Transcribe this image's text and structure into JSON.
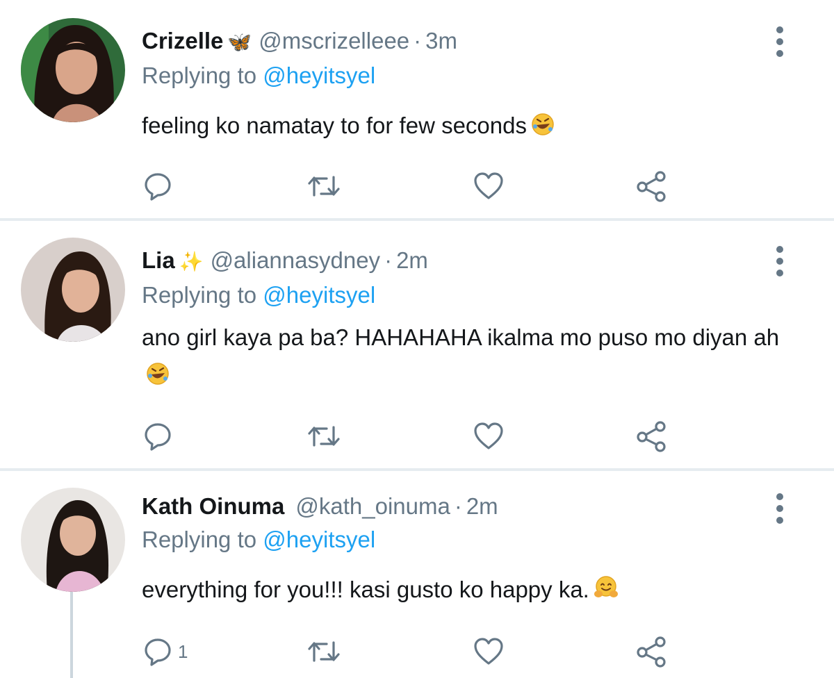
{
  "colors": {
    "accent": "#1da1f2",
    "secondary_text": "#657786",
    "divider": "#e6ecf0"
  },
  "replies": [
    {
      "name": "Crizelle",
      "badge": "🦋",
      "handle": "@mscrizelleee",
      "separator": "·",
      "time": "3m",
      "replying_label": "Replying to",
      "replying_to": "@heyitsyel",
      "text": "feeling ko namatay to for few seconds",
      "emoji": "rolling-on-floor-laughing-emoji",
      "reply_count": ""
    },
    {
      "name": "Lia",
      "badge": "✨",
      "handle": "@aliannasydney",
      "separator": "·",
      "time": "2m",
      "replying_label": "Replying to",
      "replying_to": "@heyitsyel",
      "text": "ano girl kaya pa ba? HAHAHAHA ikalma mo puso mo diyan ah",
      "emoji": "rolling-on-floor-laughing-emoji",
      "reply_count": ""
    },
    {
      "name": "Kath Oinuma",
      "badge": "",
      "handle": "@kath_oinuma",
      "separator": "·",
      "time": "2m",
      "replying_label": "Replying to",
      "replying_to": "@heyitsyel",
      "text": "everything for you!!! kasi gusto ko happy ka.",
      "emoji": "hugging-face-emoji",
      "reply_count": "1"
    }
  ],
  "icons": {
    "reply": "reply-icon",
    "retweet": "retweet-icon",
    "like": "heart-icon",
    "share": "share-icon",
    "more": "more-vertical-icon"
  }
}
